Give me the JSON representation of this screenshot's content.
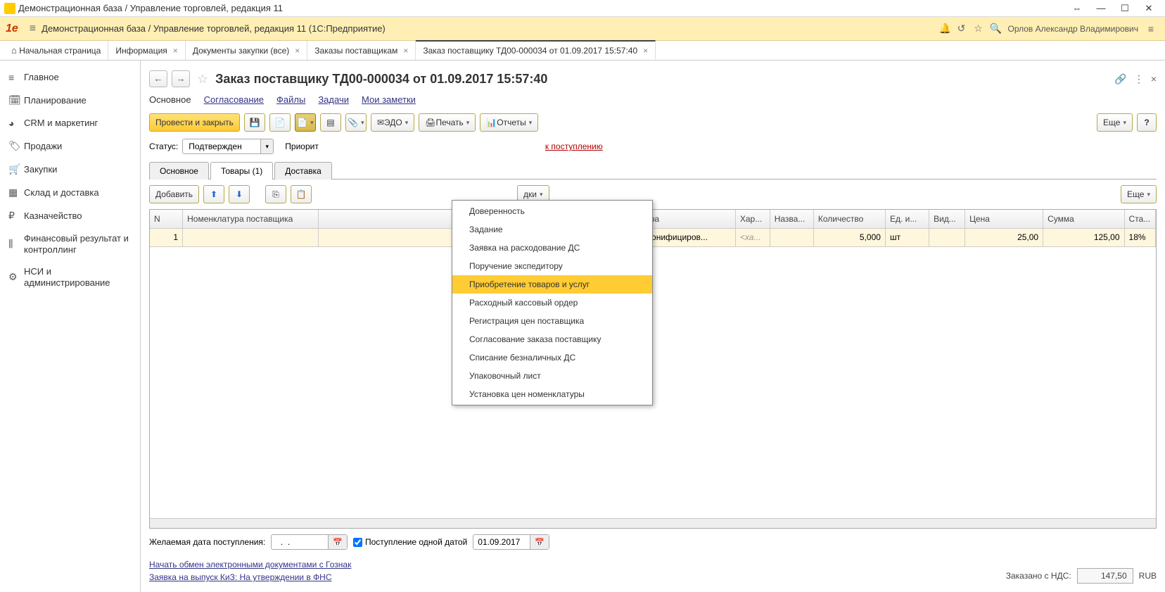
{
  "os_title": "Демонстрационная база / Управление торговлей, редакция 11",
  "app_title": "Демонстрационная база / Управление торговлей, редакция 11  (1С:Предприятие)",
  "username": "Орлов Александр Владимирович",
  "tabs": {
    "home": "Начальная страница",
    "t1": "Информация",
    "t2": "Документы закупки (все)",
    "t3": "Заказы поставщикам",
    "t4": "Заказ поставщику ТД00-000034 от 01.09.2017 15:57:40"
  },
  "sidebar": {
    "items": [
      {
        "icon": "≡",
        "label": "Главное"
      },
      {
        "icon": "🗓",
        "label": "Планирование"
      },
      {
        "icon": "◕",
        "label": "CRM и маркетинг"
      },
      {
        "icon": "🏷",
        "label": "Продажи"
      },
      {
        "icon": "🛒",
        "label": "Закупки"
      },
      {
        "icon": "▦",
        "label": "Склад и доставка"
      },
      {
        "icon": "₽",
        "label": "Казначейство"
      },
      {
        "icon": "⫼",
        "label": "Финансовый результат и контроллинг"
      },
      {
        "icon": "⚙",
        "label": "НСИ и администрирование"
      }
    ]
  },
  "doc_title": "Заказ поставщику ТД00-000034 от 01.09.2017 15:57:40",
  "subnav": {
    "main": "Основное",
    "approval": "Согласование",
    "files": "Файлы",
    "tasks": "Задачи",
    "notes": "Мои заметки"
  },
  "toolbar": {
    "post_close": "Провести и закрыть",
    "edo": "ЭДО",
    "print": "Печать",
    "reports": "Отчеты",
    "more": "Еще"
  },
  "status": {
    "label": "Статус:",
    "value": "Подтвержден",
    "priority_label": "Приорит",
    "link": "к поступлению"
  },
  "inner_tabs": {
    "main": "Основное",
    "goods": "Товары (1)",
    "delivery": "Доставка"
  },
  "tbl_toolbar": {
    "add": "Добавить",
    "disc_partial": "дки",
    "more": "Еще"
  },
  "table": {
    "cols": {
      "n": "N",
      "supplier_item": "Номенклатура поставщика",
      "item": "Номенклатура",
      "char": "Хар...",
      "name": "Назва...",
      "qty": "Количество",
      "unit": "Ед. и...",
      "type": "Вид...",
      "price": "Цена",
      "sum": "Сумма",
      "vat": "Ста..."
    },
    "row": {
      "n": "1",
      "item": "КИЗ (неперсонифициров...",
      "char": "<ха...",
      "qty": "5,000",
      "unit": "шт",
      "price": "25,00",
      "sum": "125,00",
      "vat": "18%"
    }
  },
  "dropdown": {
    "items": [
      "Доверенность",
      "Задание",
      "Заявка на расходование ДС",
      "Поручение экспедитору",
      "Приобретение товаров и услуг",
      "Расходный кассовый ордер",
      "Регистрация цен поставщика",
      "Согласование заказа поставщику",
      "Списание безналичных ДС",
      "Упаковочный лист",
      "Установка цен номенклатуры"
    ],
    "highlight_index": 4
  },
  "footer": {
    "desired_date_label": "Желаемая дата поступления:",
    "desired_date_value": "  .  .    ",
    "single_date_label": "Поступление одной датой",
    "single_date_value": "01.09.2017",
    "link1": "Начать обмен электронными документами с Гознак",
    "link2": "Заявка на выпуск КиЗ: На утверждении в ФНС",
    "total_label": "Заказано с НДС:",
    "total_value": "147,50",
    "currency": "RUB"
  }
}
